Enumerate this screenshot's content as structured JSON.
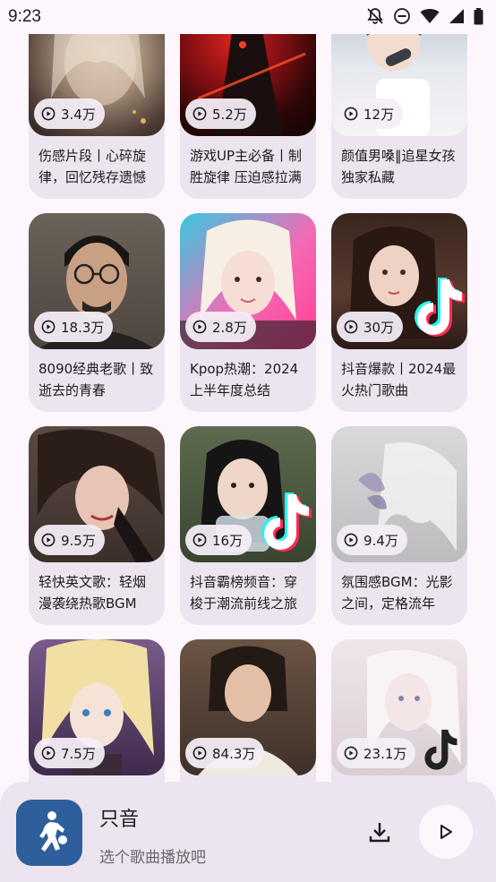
{
  "status_bar": {
    "time": "9:23",
    "icons": [
      "notifications-off-icon",
      "do-not-disturb-icon",
      "wifi-icon",
      "signal-icon",
      "battery-icon"
    ]
  },
  "playlists": [
    {
      "plays": "3.4万",
      "title": "伤感片段丨心碎旋律，回忆残存遗憾"
    },
    {
      "plays": "5.2万",
      "title": "游戏UP主必备丨制胜旋律 压迫感拉满"
    },
    {
      "plays": "12万",
      "title": "颜值男嗓‖追星女孩独家私藏"
    },
    {
      "plays": "18.3万",
      "title": "8090经典老歌丨致逝去的青春"
    },
    {
      "plays": "2.8万",
      "title": "Kpop热潮：2024上半年度总结"
    },
    {
      "plays": "30万",
      "title": "抖音爆款丨2024最火热门歌曲"
    },
    {
      "plays": "9.5万",
      "title": "轻快英文歌：轻烟漫袭绕热歌BGM"
    },
    {
      "plays": "16万",
      "title": "抖音霸榜频音：穿梭于潮流前线之旅"
    },
    {
      "plays": "9.4万",
      "title": "氛围感BGM：光影之间，定格流年"
    },
    {
      "plays": "7.5万",
      "title": ""
    },
    {
      "plays": "84.3万",
      "title": ""
    },
    {
      "plays": "23.1万",
      "title": ""
    }
  ],
  "player": {
    "app_name": "只音",
    "subtitle": "选个歌曲播放吧",
    "download_icon": "download-icon",
    "play_icon": "play-icon"
  },
  "colors": {
    "background": "#fdf7fd",
    "card": "#ece4ee",
    "player_art": "#2f5e9c"
  }
}
